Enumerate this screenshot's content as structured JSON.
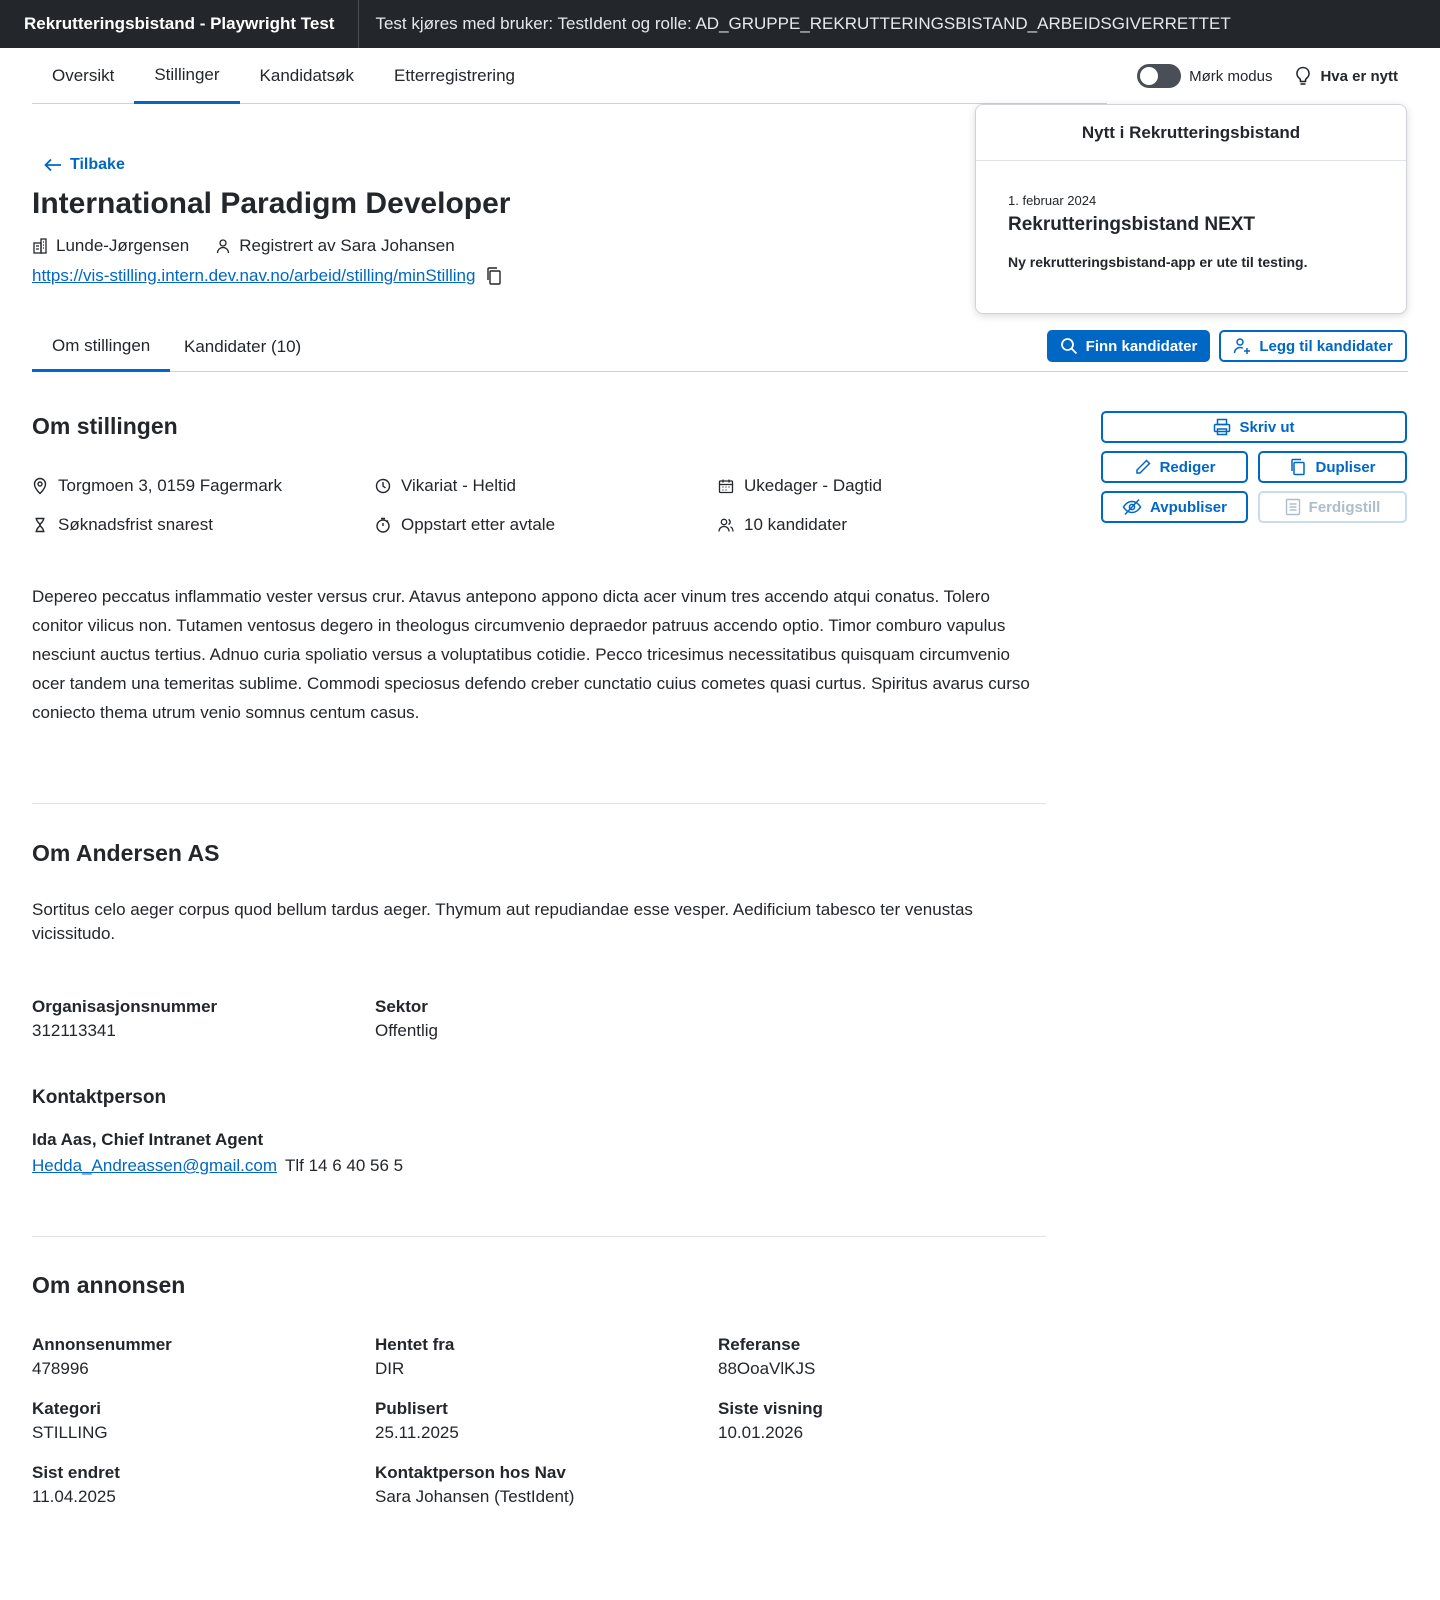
{
  "topbar": {
    "app_name": "Rekrutteringsbistand - Playwright Test",
    "info": "Test kjøres med bruker: TestIdent og rolle: AD_GRUPPE_REKRUTTERINGSBISTAND_ARBEIDSGIVERRETTET"
  },
  "nav": {
    "tabs": [
      {
        "label": "Oversikt"
      },
      {
        "label": "Stillinger"
      },
      {
        "label": "Kandidatsøk"
      },
      {
        "label": "Etterregistrering"
      }
    ],
    "active_tab": "Stillinger",
    "dark_mode_label": "Mørk modus",
    "whats_new_label": "Hva er nytt"
  },
  "popover": {
    "heading": "Nytt i Rekrutteringsbistand",
    "date": "1. februar 2024",
    "title": "Rekrutteringsbistand NEXT",
    "description": "Ny rekrutteringsbistand-app er ute til testing."
  },
  "header": {
    "back_label": "Tilbake",
    "title": "International Paradigm Developer",
    "employer": "Lunde-Jørgensen",
    "registered_by": "Registrert av Sara Johansen",
    "url": "https://vis-stilling.intern.dev.nav.no/arbeid/stilling/minStilling"
  },
  "subtabs": {
    "items": [
      {
        "label": "Om stillingen"
      },
      {
        "label": "Kandidater (10)"
      }
    ],
    "active": "Om stillingen"
  },
  "actions": {
    "find_candidates": "Finn kandidater",
    "add_candidates": "Legg til kandidater",
    "print": "Skriv ut",
    "edit": "Rediger",
    "duplicate": "Dupliser",
    "unpublish": "Avpubliser",
    "complete": "Ferdigstill"
  },
  "about_position": {
    "heading": "Om stillingen",
    "facts": {
      "address": "Torgmoen 3, 0159 Fagermark",
      "employment": "Vikariat - Heltid",
      "schedule": "Ukedager - Dagtid",
      "deadline": "Søknadsfrist snarest",
      "start": "Oppstart etter avtale",
      "candidates": "10 kandidater"
    },
    "description": "Depereo peccatus inflammatio vester versus crur. Atavus antepono appono dicta acer vinum tres accendo atqui conatus. Tolero conitor vilicus non. Tutamen ventosus degero in theologus circumvenio depraedor patruus accendo optio. Timor comburo vapulus nesciunt auctus tertius. Adnuo curia spoliatio versus a voluptatibus cotidie. Pecco tricesimus necessitatibus quisquam circumvenio ocer tandem una temeritas sublime. Commodi speciosus defendo creber cunctatio cuius cometes quasi curtus. Spiritus avarus curso coniecto thema utrum venio somnus centum casus."
  },
  "about_employer": {
    "heading": "Om Andersen AS",
    "description": "Sortitus celo aeger corpus quod bellum tardus aeger. Thymum aut repudiandae esse vesper. Aedificium tabesco ter venustas vicissitudo.",
    "org_number_label": "Organisasjonsnummer",
    "org_number": "312113341",
    "sector_label": "Sektor",
    "sector": "Offentlig",
    "contact_heading": "Kontaktperson",
    "contact_name": "Ida Aas, Chief Intranet Agent",
    "contact_email": "Hedda_Andreassen@gmail.com",
    "contact_phone": "Tlf 14 6 40 56 5"
  },
  "about_ad": {
    "heading": "Om annonsen",
    "fields": {
      "ad_number": {
        "label": "Annonsenummer",
        "value": "478996"
      },
      "source": {
        "label": "Hentet fra",
        "value": "DIR"
      },
      "reference": {
        "label": "Referanse",
        "value": "88OoaVlKJS"
      },
      "category": {
        "label": "Kategori",
        "value": "STILLING"
      },
      "published": {
        "label": "Publisert",
        "value": "25.11.2025"
      },
      "last_shown": {
        "label": "Siste visning",
        "value": "10.01.2026"
      },
      "last_changed": {
        "label": "Sist endret",
        "value": "11.04.2025"
      },
      "nav_contact": {
        "label": "Kontaktperson hos Nav",
        "value": "Sara Johansen (TestIdent)"
      }
    }
  },
  "colors": {
    "accent": "#0067c5",
    "topbar": "#23262a"
  }
}
